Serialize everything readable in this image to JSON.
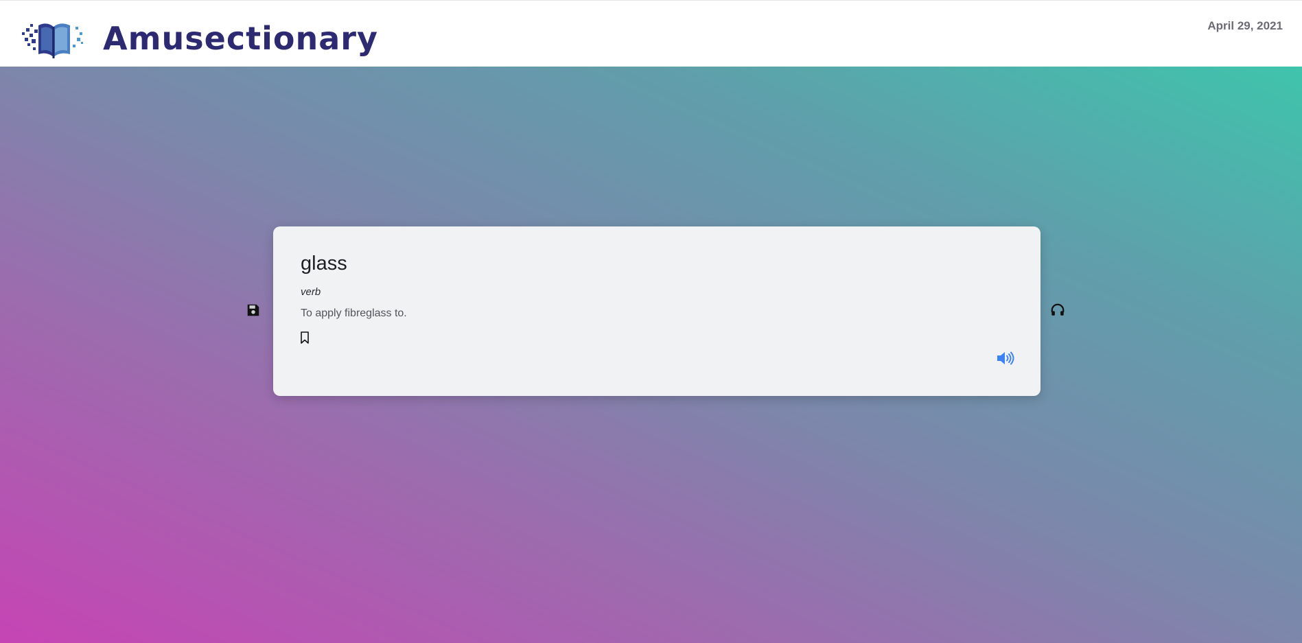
{
  "header": {
    "brand": "Amusectionary",
    "date": "April 29, 2021",
    "brand_color": "#2e2a72",
    "logo_icon": "book-logo-icon"
  },
  "background": {
    "gradient_start": "#c644b4",
    "gradient_end": "#3fc4ac"
  },
  "side_actions": {
    "left_icon": "save-icon",
    "right_icon": "headphones-icon"
  },
  "card": {
    "word": "glass",
    "part_of_speech": "verb",
    "definition": "To apply fibreglass to.",
    "bookmark_icon": "bookmark-icon",
    "audio_icon": "speaker-icon",
    "audio_color": "#3b82f6"
  }
}
